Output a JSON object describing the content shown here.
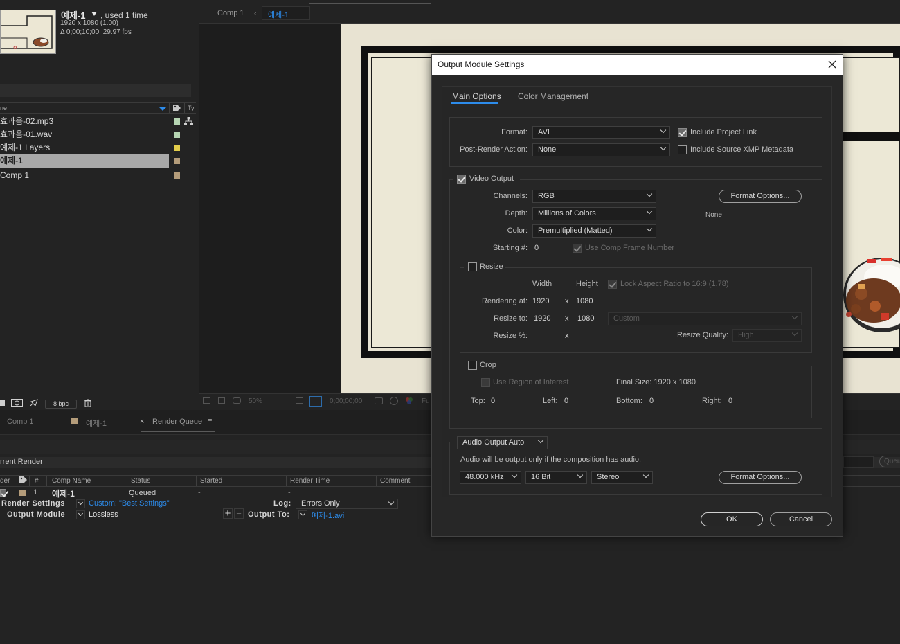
{
  "project": {
    "comp_name": "예제-1",
    "used": ", used 1 time",
    "resolution": "1920 x 1080 (1.00)",
    "duration": "Δ 0;00;10;00, 29.97 fps",
    "col_name": "ne",
    "col_type": "Ty",
    "items": [
      {
        "label": "효과음-02.mp3",
        "color": "#b6d5b3"
      },
      {
        "label": "효과음-01.wav",
        "color": "#b6d5b3"
      },
      {
        "label": "예제-1 Layers",
        "color": "#e2cc4a"
      },
      {
        "label": "예제-1",
        "color": "#b49c7a",
        "selected": true
      },
      {
        "label": "Comp 1",
        "color": "#b49c7a"
      }
    ],
    "bpc": "8 bpc"
  },
  "viewer": {
    "breadcrumb_comp1": "Comp 1",
    "breadcrumb_current": "예제-1",
    "zoom": "50%",
    "timecode": "0;00;00;00",
    "full": "Fu"
  },
  "render_queue": {
    "tabs": [
      "Comp 1",
      "예제-1",
      "Render Queue"
    ],
    "current_render": "rrent Render",
    "queue_btn": "Queu",
    "columns": {
      "render": "der",
      "num": "#",
      "comp_name": "Comp Name",
      "status": "Status",
      "started": "Started",
      "render_time": "Render Time",
      "comment": "Comment"
    },
    "item": {
      "num": "1",
      "comp": "예제-1",
      "status": "Queued",
      "started": "-",
      "render_time": "-"
    },
    "render_settings_label": "Render Settings",
    "render_settings_value": "Custom: \"Best Settings\"",
    "log_label": "Log:",
    "log_value": "Errors Only",
    "output_module_label": "Output Module",
    "output_module_value": "Lossless",
    "output_to_label": "Output To:",
    "output_to_value": "예제-1.avi"
  },
  "dialog": {
    "title": "Output Module Settings",
    "tabs": {
      "main": "Main Options",
      "color": "Color Management"
    },
    "format_label": "Format:",
    "format_value": "AVI",
    "include_project_link": "Include Project Link",
    "post_render_label": "Post-Render Action:",
    "post_render_value": "None",
    "include_xmp": "Include Source XMP Metadata",
    "video_output": "Video Output",
    "channels_label": "Channels:",
    "channels_value": "RGB",
    "depth_label": "Depth:",
    "depth_value": "Millions of Colors",
    "color_label": "Color:",
    "color_value": "Premultiplied (Matted)",
    "starting_label": "Starting #:",
    "starting_value": "0",
    "use_comp_frame": "Use Comp Frame Number",
    "format_options": "Format Options...",
    "codec_none": "None",
    "resize": "Resize",
    "width_hdr": "Width",
    "height_hdr": "Height",
    "lock_aspect": "Lock Aspect Ratio to 16:9 (1.78)",
    "rendering_at_label": "Rendering at:",
    "render_w": "1920",
    "render_h": "1080",
    "resize_to_label": "Resize to:",
    "resize_w": "1920",
    "resize_h": "1080",
    "resize_preset": "Custom",
    "resize_pct_label": "Resize %:",
    "x": "x",
    "resize_quality_label": "Resize Quality:",
    "resize_quality_value": "High",
    "crop": "Crop",
    "use_roi": "Use Region of Interest",
    "final_size": "Final Size: 1920 x 1080",
    "top_label": "Top:",
    "top_val": "0",
    "left_label": "Left:",
    "left_val": "0",
    "bottom_label": "Bottom:",
    "bottom_val": "0",
    "right_label": "Right:",
    "right_val": "0",
    "audio_output": "Audio Output Auto",
    "audio_note": "Audio will be output only if the composition has audio.",
    "sample_rate": "48.000 kHz",
    "bit_depth": "16 Bit",
    "channels_audio": "Stereo",
    "audio_format_options": "Format Options...",
    "ok": "OK",
    "cancel": "Cancel"
  }
}
